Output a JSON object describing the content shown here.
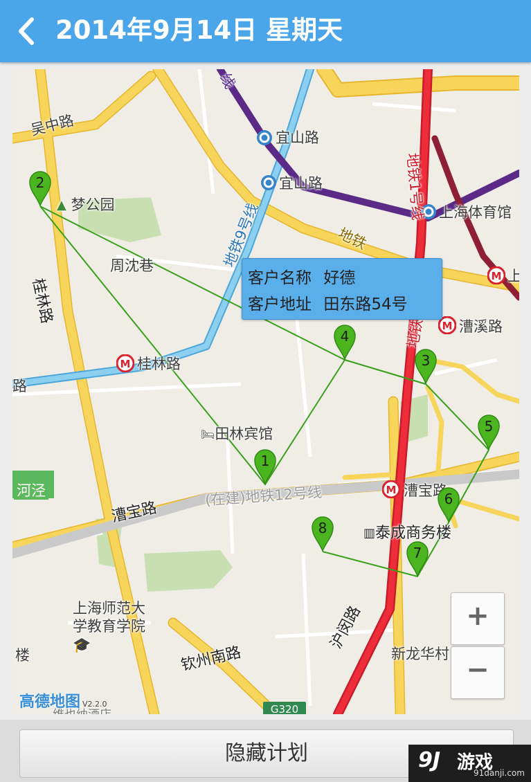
{
  "header": {
    "title": "2014年9月14日 星期天"
  },
  "map": {
    "street_labels": [
      {
        "key": "wuzhong",
        "text": "吴中路"
      },
      {
        "key": "guilin_rd",
        "text": "桂林路"
      },
      {
        "key": "cao_bao_rd",
        "text": "漕宝路"
      },
      {
        "key": "qinzhou_south",
        "text": "钦州南路"
      },
      {
        "key": "humin",
        "text": "沪闵路"
      },
      {
        "key": "zhoushen",
        "text": "周沈巷"
      }
    ],
    "metro_line_labels": [
      {
        "key": "line9",
        "text": "地铁9号线"
      },
      {
        "key": "line1_a",
        "text": "地铁1号线"
      },
      {
        "key": "line1_b",
        "text": "地铁1号线"
      },
      {
        "key": "line4",
        "text": "地铁"
      },
      {
        "key": "line12",
        "text": "(在建)地铁12号线"
      },
      {
        "key": "line3",
        "text": "线"
      },
      {
        "key": "line_rd",
        "text": "路"
      }
    ],
    "stations": [
      {
        "key": "yishan1",
        "text": "宜山路"
      },
      {
        "key": "yishan2",
        "text": "宜山路"
      },
      {
        "key": "stadium",
        "text": "上海体育馆"
      },
      {
        "key": "caoxi",
        "text": "漕溪路"
      },
      {
        "key": "guilin_station",
        "text": "桂林路"
      },
      {
        "key": "caobao_station",
        "text": "漕宝路"
      },
      {
        "key": "shang",
        "text": "上"
      }
    ],
    "pois": [
      {
        "key": "mengyuan",
        "text": "梦公园"
      },
      {
        "key": "tianlin",
        "text": "田林宾馆"
      },
      {
        "key": "taicheng",
        "text": "泰成商务楼"
      },
      {
        "key": "normal_univ",
        "text": "上海师范大学教育学院"
      },
      {
        "key": "xinlonghua",
        "text": "新龙华村"
      },
      {
        "key": "hejing",
        "text": "河泾"
      },
      {
        "key": "lou",
        "text": "楼"
      },
      {
        "key": "hotel",
        "text": "维也纳酒店"
      }
    ],
    "markers": [
      {
        "label": "1"
      },
      {
        "label": "2"
      },
      {
        "label": "3"
      },
      {
        "label": "4"
      },
      {
        "label": "5"
      },
      {
        "label": "6"
      },
      {
        "label": "7"
      },
      {
        "label": "8"
      }
    ],
    "route_order": [
      "2",
      "1",
      "4",
      "3",
      "5",
      "6",
      "7",
      "8"
    ],
    "popup": {
      "name_label": "客户名称",
      "name_value": "好德",
      "address_label": "客户地址",
      "address_value": "田东路54号"
    },
    "zoom_in": "+",
    "zoom_out": "−",
    "provider": "高德地图",
    "provider_version": "V2.2.0",
    "highway_shield": "G320",
    "colors": {
      "route": "#3aa01c",
      "marker": "#4ab51f",
      "header": "#4aa6e8",
      "metro_red": "#e8202e",
      "metro_purple": "#5a2a86",
      "metro_blue": "#5cb8e6",
      "metro_maroon": "#8e1f35",
      "road_yellow": "#f5c93b"
    }
  },
  "footer": {
    "hide_plan_button": "隐藏计划"
  },
  "watermark": {
    "brand": "游戏",
    "logo": "9J",
    "site": "91danji.com"
  }
}
